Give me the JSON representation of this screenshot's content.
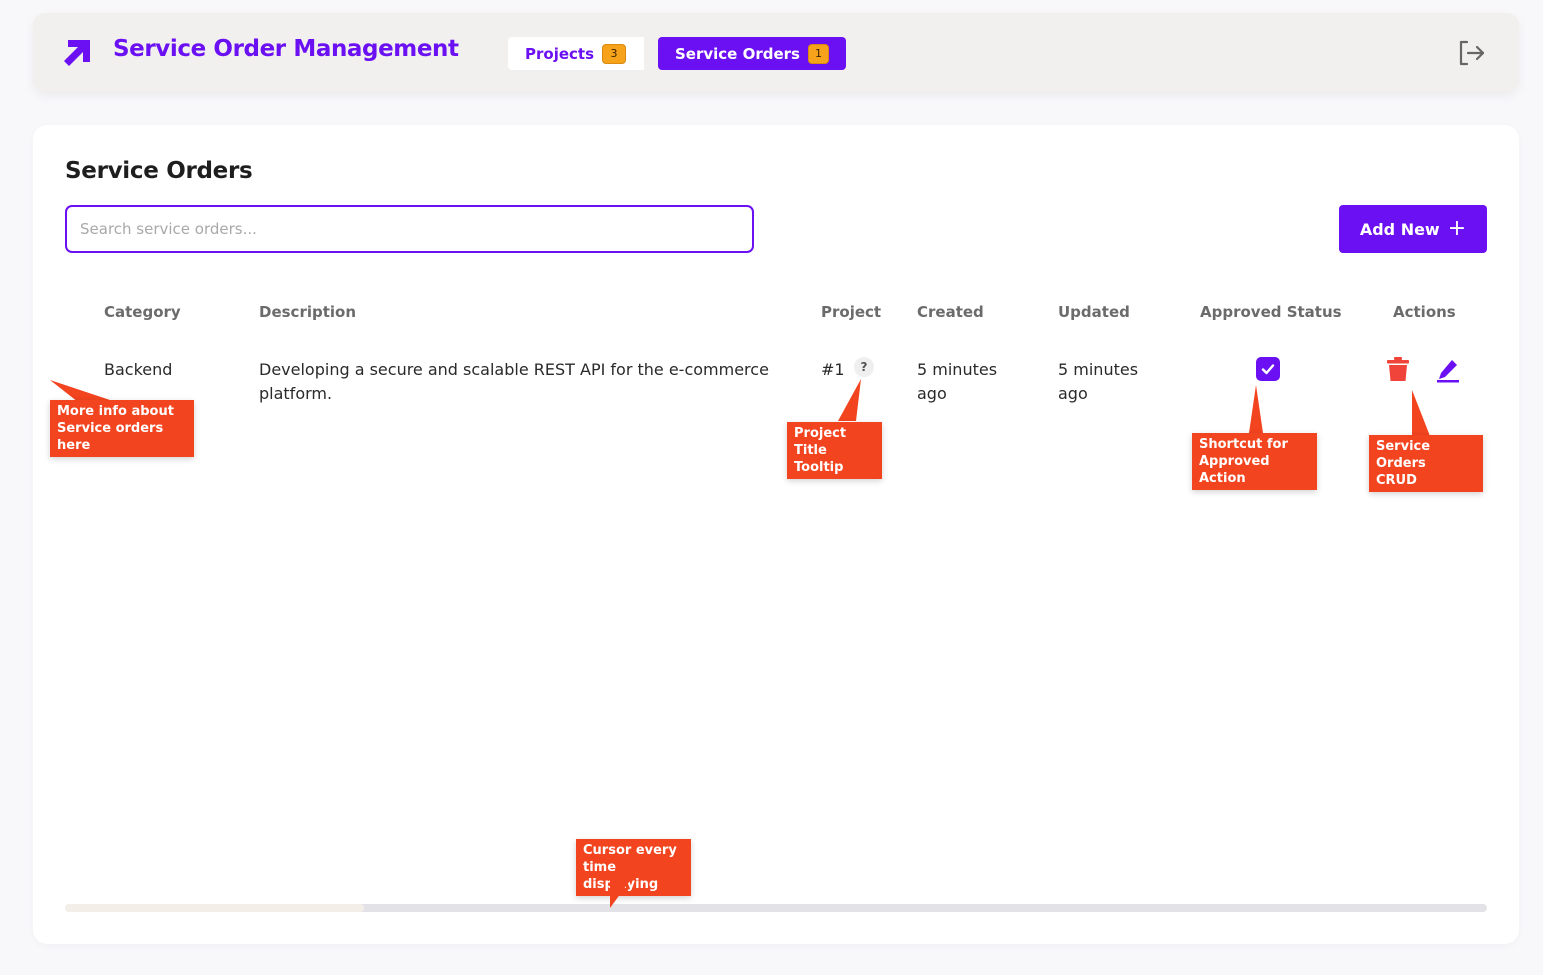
{
  "app": {
    "title": "Service Order Management",
    "brand_color": "#6a10f2"
  },
  "nav": {
    "tabs": [
      {
        "label": "Projects",
        "count": "3",
        "active": false
      },
      {
        "label": "Service Orders",
        "count": "1",
        "active": true
      }
    ]
  },
  "icons": {
    "logo": "arrow-up-right-icon",
    "logout": "logout-icon",
    "help": "question-icon",
    "approved": "checkbox-checked-icon",
    "delete": "trash-icon",
    "edit": "pencil-icon"
  },
  "page": {
    "title": "Service Orders",
    "search_placeholder": "Search service orders...",
    "add_button_label": "Add New",
    "add_button_icon": "+"
  },
  "table": {
    "headers": {
      "category": "Category",
      "description": "Description",
      "project": "Project",
      "created": "Created",
      "updated": "Updated",
      "approved_status": "Approved Status",
      "actions": "Actions"
    },
    "rows": [
      {
        "category": "Backend",
        "description": "Developing a secure and scalable REST API for the e-commerce platform.",
        "project": "#1",
        "project_help": "?",
        "created": "5 minutes ago",
        "updated": "5 minutes ago",
        "approved": true
      }
    ]
  },
  "annotations": {
    "more_info": "More info about\nService orders here",
    "project_tooltip": "Project Title\nTooltip",
    "shortcut_approved": "Shortcut for\nApproved Action",
    "crud": "Service Orders\nCRUD",
    "cursor": "Cursor every\ntime displaying"
  },
  "colors": {
    "accent": "#6a10f2",
    "badge": "#f7a21b",
    "danger": "#f0443a",
    "annotation": "#f2441f"
  }
}
